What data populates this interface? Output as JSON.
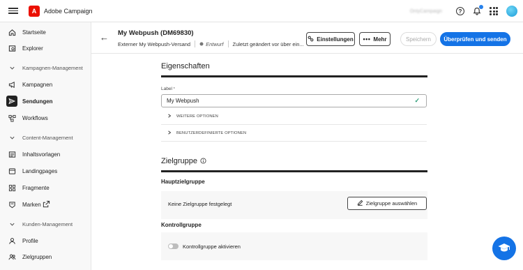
{
  "app": {
    "title": "Adobe Campaign",
    "org_name": "OnlyCampaign"
  },
  "colors": {
    "accent": "#1473e6",
    "brand": "#eb1000",
    "success": "#2d9d78"
  },
  "sidebar": {
    "items": [
      {
        "label": "Startseite",
        "icon": "home-icon"
      },
      {
        "label": "Explorer",
        "icon": "explorer-icon"
      },
      {
        "label": "Kampagnen-Management",
        "icon": "chevron-down-icon",
        "section": true
      },
      {
        "label": "Kampagnen",
        "icon": "megaphone-icon"
      },
      {
        "label": "Sendungen",
        "icon": "send-icon",
        "active": true
      },
      {
        "label": "Workflows",
        "icon": "workflow-icon"
      },
      {
        "label": "Content-Management",
        "icon": "chevron-down-icon",
        "section": true
      },
      {
        "label": "Inhaltsvorlagen",
        "icon": "template-icon"
      },
      {
        "label": "Landingpages",
        "icon": "landingpage-icon"
      },
      {
        "label": "Fragmente",
        "icon": "fragments-icon"
      },
      {
        "label": "Marken",
        "icon": "brand-icon"
      },
      {
        "label": "Kunden-Management",
        "icon": "chevron-down-icon",
        "section": true
      },
      {
        "label": "Profile",
        "icon": "profile-icon"
      },
      {
        "label": "Zielgruppen",
        "icon": "audiences-icon"
      }
    ]
  },
  "header": {
    "title": "My Webpush (DM69830)",
    "channel": "Externer My Webpush-Versand",
    "status": "Entwurf",
    "modified": "Zuletzt geändert vor über ein...",
    "settings_label": "Einstellungen",
    "more_label": "Mehr",
    "save_label": "Speichern",
    "review_label": "Überprüfen und senden"
  },
  "properties": {
    "title": "Eigenschaften",
    "label_field": {
      "label": "Label",
      "required_mark": "*",
      "value": "My Webpush"
    },
    "more_options": "WEITERE OPTIONEN",
    "custom_options": "BENUTZERDEFINIERTE OPTIONEN"
  },
  "audience": {
    "title": "Zielgruppe",
    "main_title": "Hauptzielgruppe",
    "none_text": "Keine Zielgruppe festgelegt",
    "select_label": "Zielgruppe auswählen",
    "control_title": "Kontrollgruppe",
    "control_toggle_label": "Kontrollgruppe aktivieren",
    "control_enabled": false
  }
}
